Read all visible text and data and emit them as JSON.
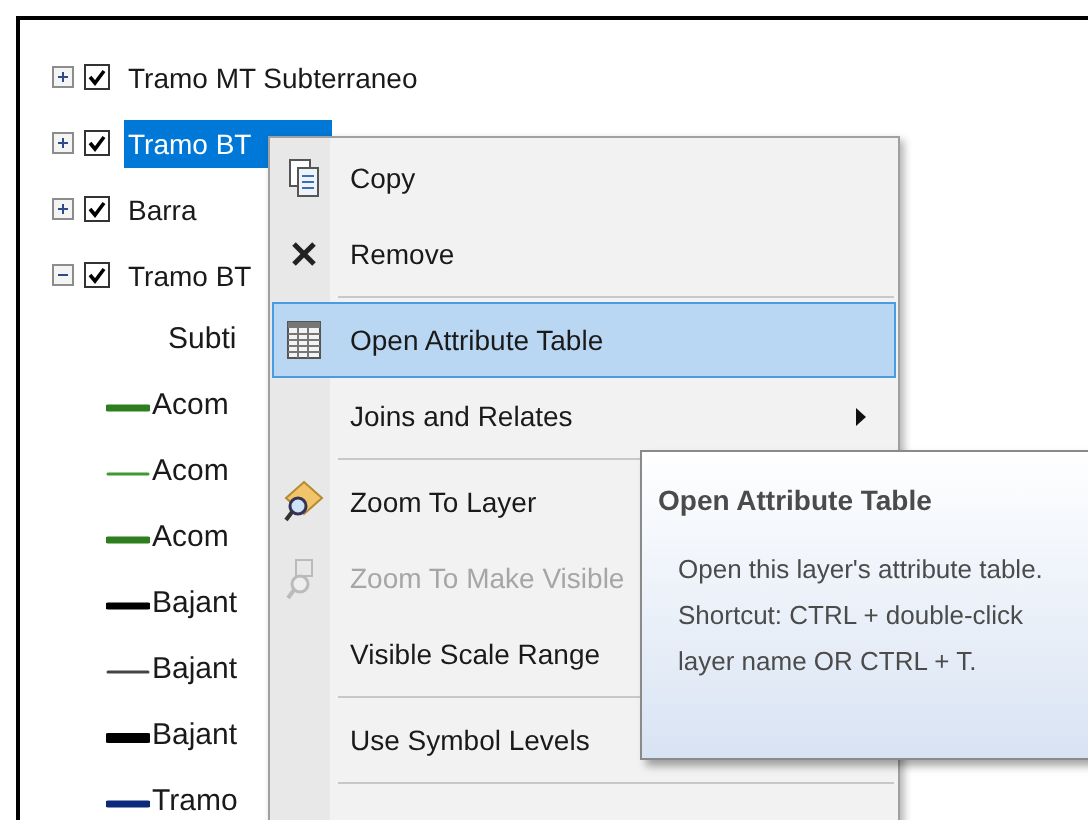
{
  "tree": [
    {
      "label": "Tramo MT Subterraneo",
      "expanded": false,
      "checked": true,
      "selected": false
    },
    {
      "label": "Tramo BT",
      "expanded": false,
      "checked": true,
      "selected": true
    },
    {
      "label": "Barra",
      "expanded": false,
      "checked": true,
      "selected": false
    },
    {
      "label": "Tramo BT",
      "expanded": true,
      "checked": true,
      "selected": false,
      "children": [
        {
          "kind": "heading",
          "label": "Subti"
        },
        {
          "kind": "thick",
          "label": "Acom",
          "color": "#2e7d1f"
        },
        {
          "kind": "thin",
          "label": "Acom",
          "color": "#3f9a2e"
        },
        {
          "kind": "thick",
          "label": "Acom",
          "color": "#2e7d1f"
        },
        {
          "kind": "thick",
          "label": "Bajant",
          "color": "#000000"
        },
        {
          "kind": "thin",
          "label": "Bajant",
          "color": "#444444"
        },
        {
          "kind": "heavy",
          "label": "Bajant",
          "color": "#000000"
        },
        {
          "kind": "thick",
          "label": "Tramo",
          "color": "#0d2a7a"
        }
      ]
    }
  ],
  "context_menu": [
    {
      "kind": "item",
      "label": "Copy",
      "selected": false,
      "disabled": false
    },
    {
      "kind": "item",
      "label": "Remove",
      "selected": false,
      "disabled": false
    },
    {
      "kind": "separator"
    },
    {
      "kind": "item",
      "label": "Open Attribute Table",
      "selected": true,
      "disabled": false
    },
    {
      "kind": "item",
      "label": "Joins and Relates",
      "selected": false,
      "disabled": false,
      "submenu": true
    },
    {
      "kind": "separator"
    },
    {
      "kind": "item",
      "label": "Zoom To Layer",
      "selected": false,
      "disabled": false
    },
    {
      "kind": "item",
      "label": "Zoom To Make Visible",
      "selected": false,
      "disabled": true
    },
    {
      "kind": "item",
      "label": "Visible Scale Range",
      "selected": false,
      "disabled": false
    },
    {
      "kind": "separator"
    },
    {
      "kind": "item",
      "label": "Use Symbol Levels",
      "selected": false,
      "disabled": false
    },
    {
      "kind": "separator"
    }
  ],
  "tooltip": {
    "title": "Open Attribute Table",
    "lines": [
      "Open this layer's attribute table.",
      "Shortcut: CTRL + double-click",
      "layer name OR CTRL + T."
    ]
  }
}
